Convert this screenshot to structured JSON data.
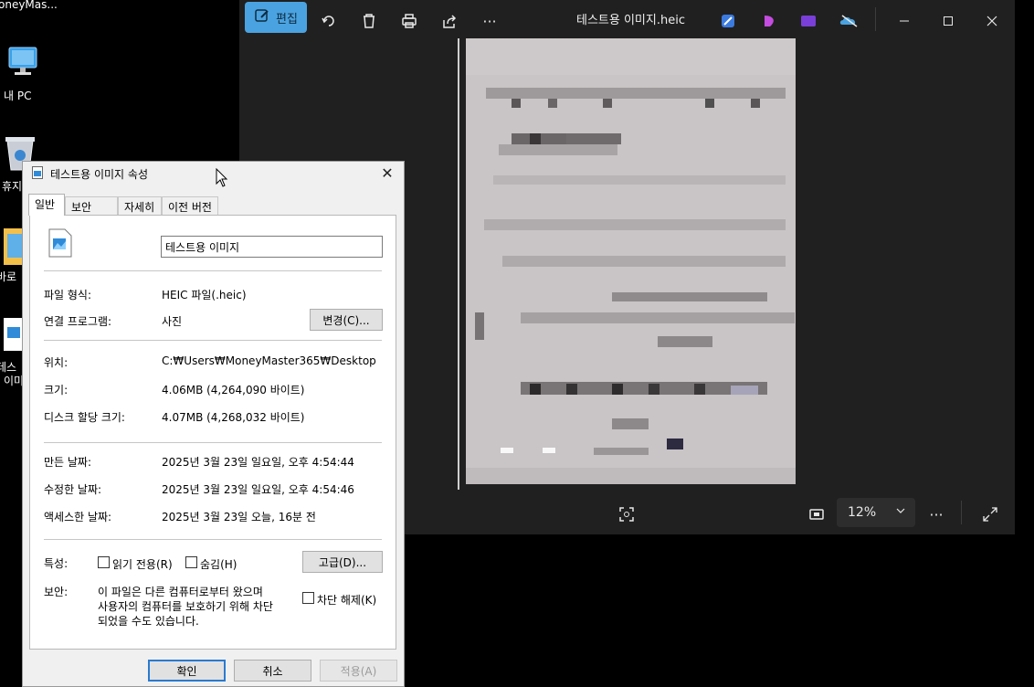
{
  "desktop": {
    "items": [
      {
        "label": "oneyMas..."
      },
      {
        "label": "내 PC"
      },
      {
        "label": "휴지"
      },
      {
        "label": "바로"
      },
      {
        "label": "테스"
      },
      {
        "label": "이미"
      }
    ]
  },
  "viewer": {
    "edit_label": "편집",
    "title": "테스트용 이미지.heic",
    "zoom": "12%",
    "more": "···"
  },
  "dialog": {
    "title": "테스트용 이미지 속성",
    "tabs": [
      "일반",
      "보안",
      "자세히",
      "이전 버전"
    ],
    "filename_value": "테스트용 이미지",
    "file_type_label": "파일 형식:",
    "file_type_value": "HEIC 파일(.heic)",
    "opens_with_label": "연결 프로그램:",
    "opens_with_value": "사진",
    "change_button": "변경(C)...",
    "location_label": "위치:",
    "location_value": "C:₩Users₩MoneyMaster365₩Desktop",
    "size_label": "크기:",
    "size_value": "4.06MB (4,264,090 바이트)",
    "disk_size_label": "디스크 할당 크기:",
    "disk_size_value": "4.07MB (4,268,032 바이트)",
    "created_label": "만든 날짜:",
    "created_value": "2025년 3월 23일 일요일, 오후 4:54:44",
    "modified_label": "수정한 날짜:",
    "modified_value": "2025년 3월 23일 일요일, 오후 4:54:46",
    "accessed_label": "액세스한 날짜:",
    "accessed_value": "2025년 3월 23일 오늘, 16분 전",
    "attributes_label": "특성:",
    "readonly_label": "읽기 전용(R)",
    "hidden_label": "숨김(H)",
    "advanced_button": "고급(D)...",
    "security_label": "보안:",
    "security_line1": "이 파일은 다른 컴퓨터로부터 왔으며",
    "security_line2": "사용자의 컴퓨터를 보호하기 위해 차단",
    "security_line3": "되었을 수도 있습니다.",
    "unblock_label": "차단 해제(K)",
    "ok_button": "확인",
    "cancel_button": "취소",
    "apply_button": "적용(A)"
  }
}
